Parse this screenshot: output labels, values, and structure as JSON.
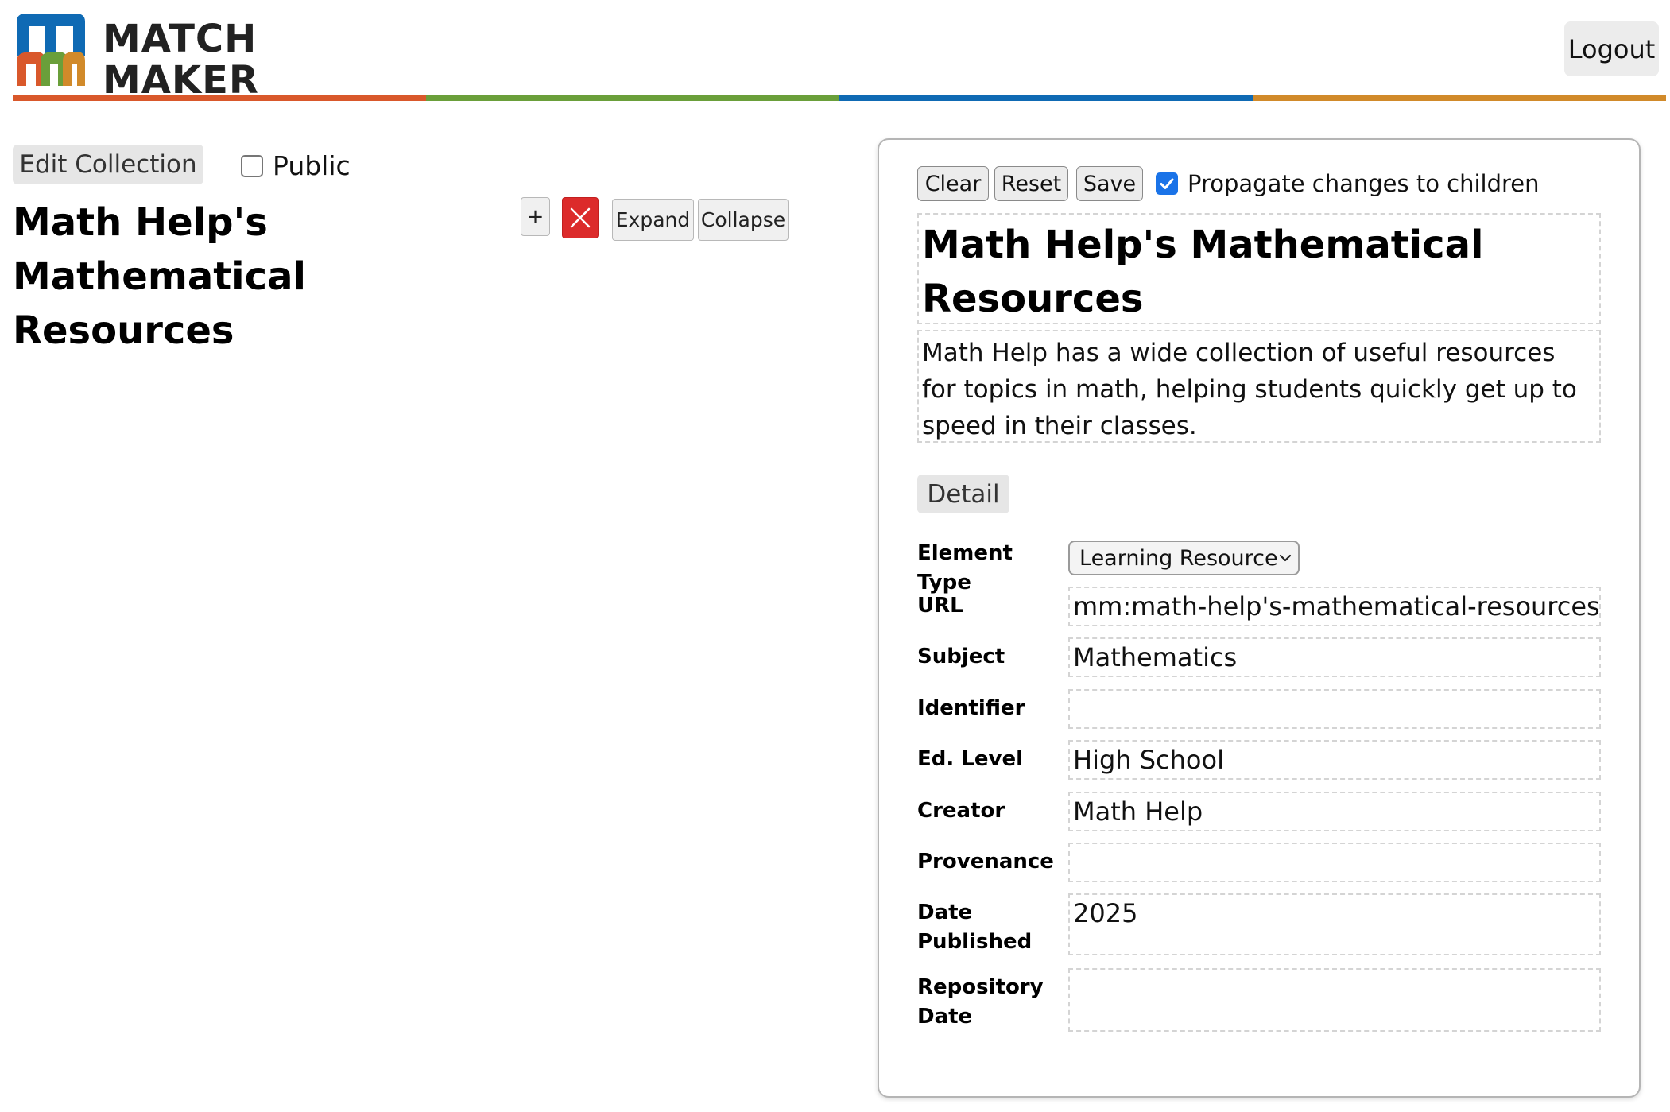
{
  "header": {
    "logo": {
      "line1": "Match",
      "line2": "Maker"
    },
    "logout_label": "Logout",
    "color_bar": [
      "#d9582b",
      "#6a9f3a",
      "#0f6ab4",
      "#d18a2a"
    ]
  },
  "left_panel": {
    "edit_collection_label": "Edit Collection",
    "public_label": "Public",
    "public_checked": false,
    "collection_title": "Math Help's Mathematical Resources",
    "add_label": "+",
    "expand_label": "Expand",
    "collapse_label": "Collapse"
  },
  "editor": {
    "clear_label": "Clear",
    "reset_label": "Reset",
    "save_label": "Save",
    "propagate_label": "Propagate changes to children",
    "propagate_checked": true,
    "title": "Math Help's Mathematical Resources",
    "description": "Math Help has a wide collection of useful resources for topics in math, helping students quickly get up to speed in their classes.",
    "detail_label": "Detail",
    "fields": {
      "element_type": {
        "label": "Element Type",
        "value": "Learning Resource"
      },
      "url": {
        "label": "URL",
        "value": "mm:math-help's-mathematical-resources"
      },
      "subject": {
        "label": "Subject",
        "value": "Mathematics"
      },
      "identifier": {
        "label": "Identifier",
        "value": ""
      },
      "ed_level": {
        "label": "Ed. Level",
        "value": "High School"
      },
      "creator": {
        "label": "Creator",
        "value": "Math Help"
      },
      "provenance": {
        "label": "Provenance",
        "value": ""
      },
      "date_published": {
        "label": "Date Published",
        "value": "2025"
      },
      "repository_date": {
        "label": "Repository Date",
        "value": ""
      }
    }
  },
  "colors": {
    "accent_blue": "#1a73e8",
    "delete_red": "#dc2b2b"
  }
}
